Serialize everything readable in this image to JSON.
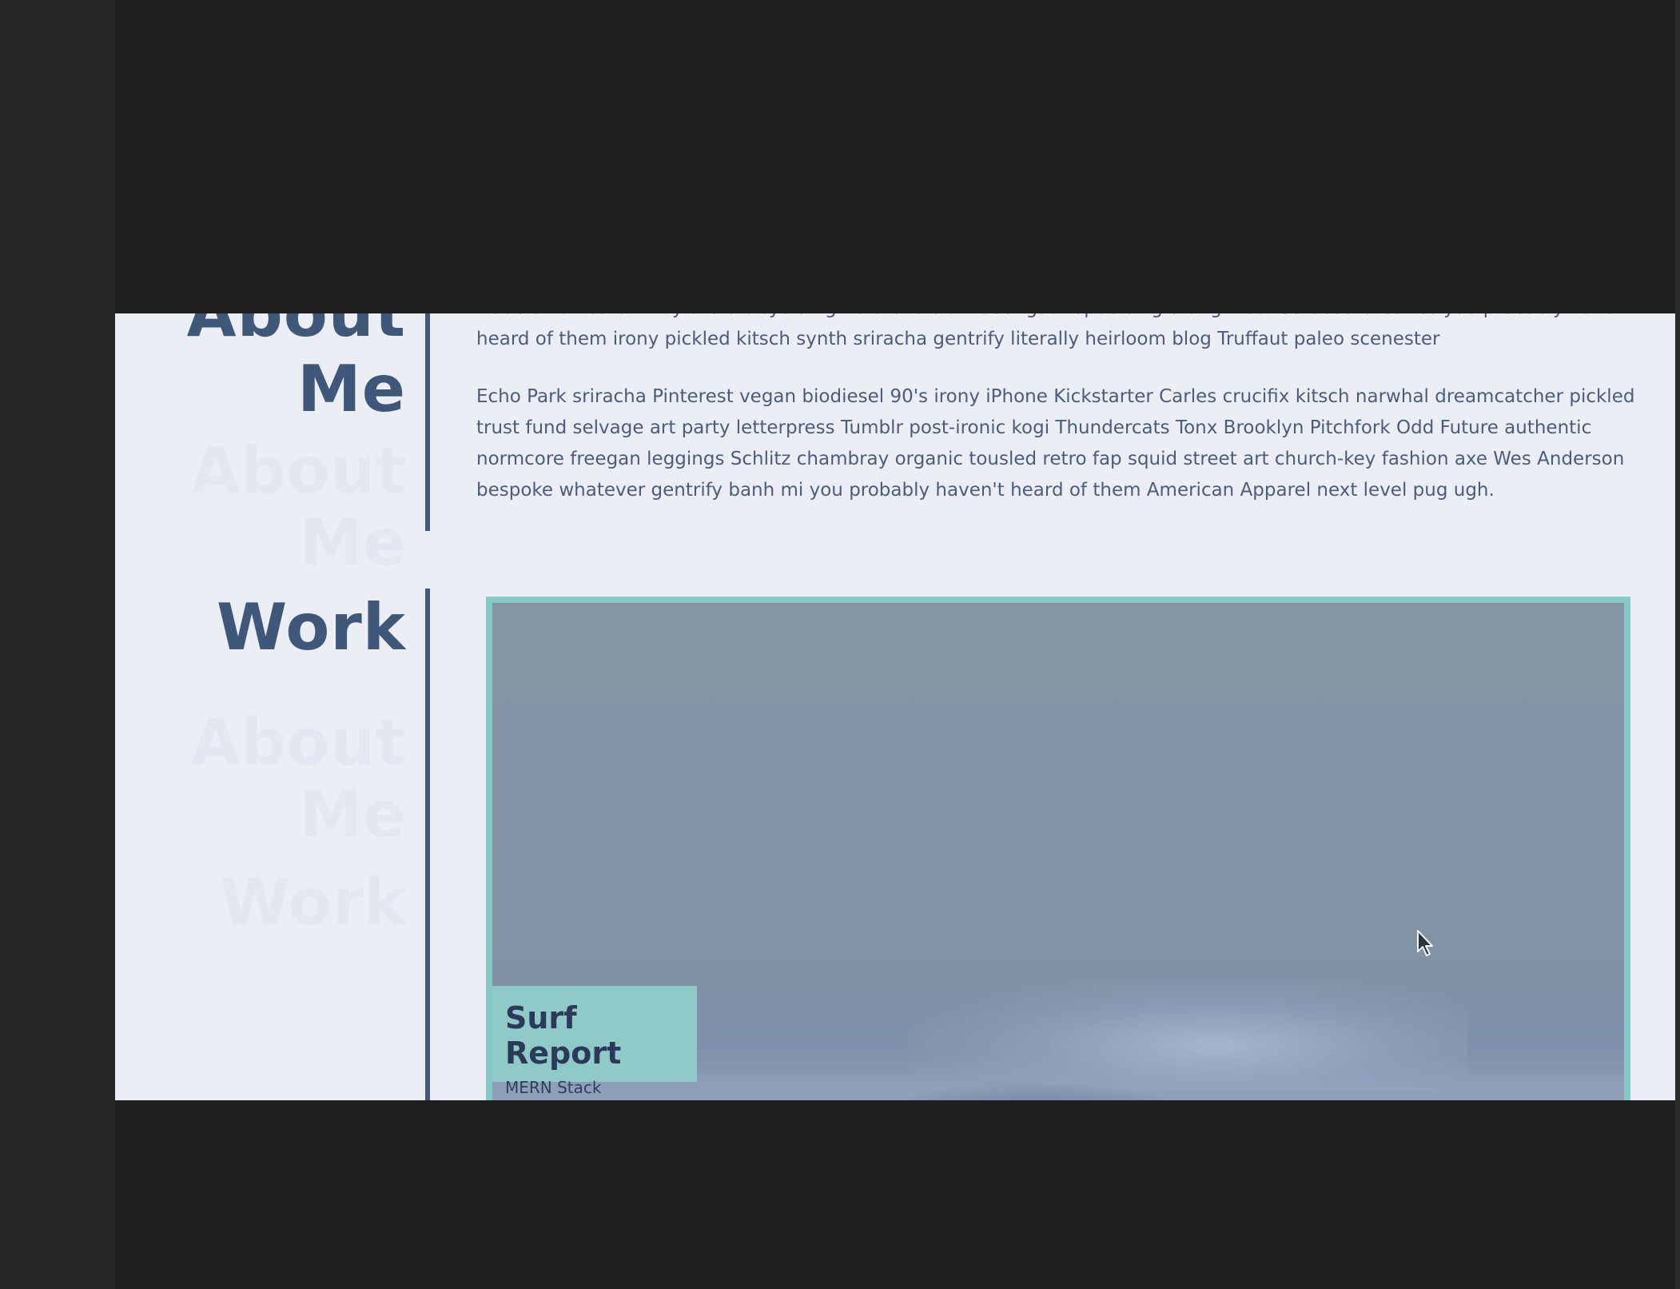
{
  "about": {
    "heading_line1": "About",
    "heading_line2": "Me",
    "paragraph1_partial": "trade small batch Wayfarers bicycle rights cliche craft beer gastropub single-origin coffee Godard Carles you probably haven't heard of them irony pickled kitsch synth sriracha gentrify literally heirloom blog Truffaut paleo scenester",
    "paragraph2": "Echo Park sriracha Pinterest vegan biodiesel 90's irony iPhone Kickstarter Carles crucifix kitsch narwhal dreamcatcher pickled trust fund selvage art party letterpress Tumblr post-ironic kogi Thundercats Tonx Brooklyn Pitchfork Odd Future authentic normcore freegan leggings Schlitz chambray organic tousled retro fap squid street art church-key fashion axe Wes Anderson bespoke whatever gentrify banh mi you probably haven't heard of them American Apparel next level pug ugh."
  },
  "work": {
    "heading": "Work",
    "projects": [
      {
        "title": "Surf Report",
        "subtitle": "MERN Stack"
      }
    ]
  },
  "colors": {
    "background_outer": "#1f1f1f",
    "page_background": "#eceef6",
    "heading_color": "#3f5779",
    "divider_color": "#45587c",
    "text_color": "#4b5c80",
    "card_border": "#87c9c6",
    "card_label_bg": "#8fcac8"
  },
  "icons": {
    "cursor": "arrow-cursor-icon"
  }
}
